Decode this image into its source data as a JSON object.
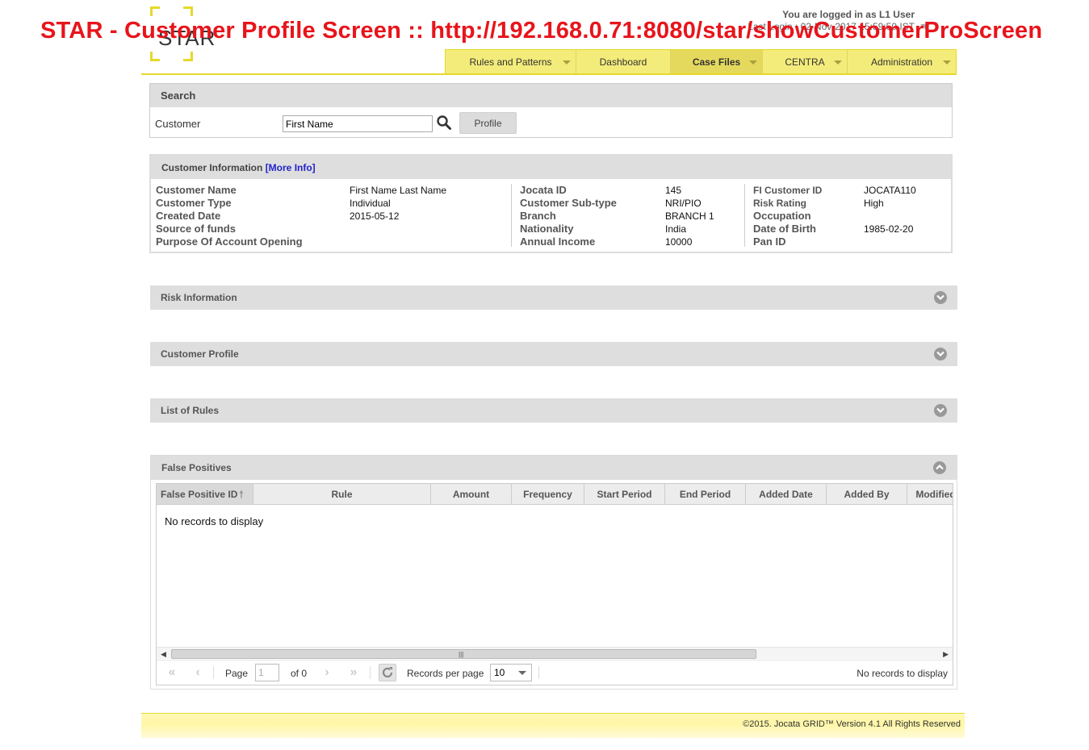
{
  "overlay_title": "STAR - Customer Profile Screen :: http://192.168.0.71:8080/star/showCustomerProScreen",
  "logo": {
    "text": "STAR"
  },
  "user": {
    "logged_in": "You are logged in as L1 User",
    "last_login": "Last Login : 02-Nov-2017 15:59:50 IST"
  },
  "nav": [
    {
      "label": "Rules and Patterns",
      "has_dropdown": true
    },
    {
      "label": "Dashboard",
      "has_dropdown": false
    },
    {
      "label": "Case Files",
      "has_dropdown": true,
      "active": true
    },
    {
      "label": "CENTRA",
      "has_dropdown": true
    },
    {
      "label": "Administration",
      "has_dropdown": true
    }
  ],
  "search": {
    "title": "Search",
    "customer_label": "Customer",
    "customer_value": "First Name",
    "search_icon": "search-icon",
    "profile_button": "Profile"
  },
  "customer_info": {
    "title": "Customer Information",
    "more_info": "[More Info]",
    "col1": [
      {
        "label": "Customer Name",
        "value": "First Name Last Name"
      },
      {
        "label": "Customer Type",
        "value": "Individual"
      },
      {
        "label": "Created Date",
        "value": "2015-05-12"
      },
      {
        "label": "Source of funds",
        "value": ""
      },
      {
        "label": "Purpose Of Account Opening",
        "value": ""
      }
    ],
    "col2": [
      {
        "label": "Jocata ID",
        "value": "145"
      },
      {
        "label": "Customer Sub-type",
        "value": "NRI/PIO"
      },
      {
        "label": "Branch",
        "value": "BRANCH 1"
      },
      {
        "label": "Nationality",
        "value": "India"
      },
      {
        "label": "Annual Income",
        "value": "10000"
      }
    ],
    "col3": [
      {
        "label": "FI Customer ID",
        "value": "JOCATA110"
      },
      {
        "label": "Risk Rating",
        "value": "High"
      },
      {
        "label": "Occupation",
        "value": ""
      },
      {
        "label": "Date of Birth",
        "value": "1985-02-20"
      },
      {
        "label": "Pan ID",
        "value": ""
      }
    ]
  },
  "sections": {
    "risk_information": "Risk Information",
    "customer_profile": "Customer Profile",
    "list_of_rules": "List of Rules",
    "false_positives": "False Positives"
  },
  "false_positives_grid": {
    "columns": [
      "False Positive ID",
      "Rule",
      "Amount",
      "Frequency",
      "Start Period",
      "End Period",
      "Added Date",
      "Added By",
      "Modified"
    ],
    "empty_message": "No records to display",
    "pager": {
      "page_label": "Page",
      "page_value": "1",
      "of_label": "of 0",
      "records_per_page_label": "Records per page",
      "records_per_page_value": "10",
      "status": "No records to display"
    }
  },
  "footer": {
    "copyright": "©2015. Jocata GRID™ Version 4.1 All Rights Reserved"
  },
  "colors": {
    "accent_yellow": "#e5d92a",
    "overlay_red": "#e8141b",
    "panel_gray": "#dedede"
  }
}
